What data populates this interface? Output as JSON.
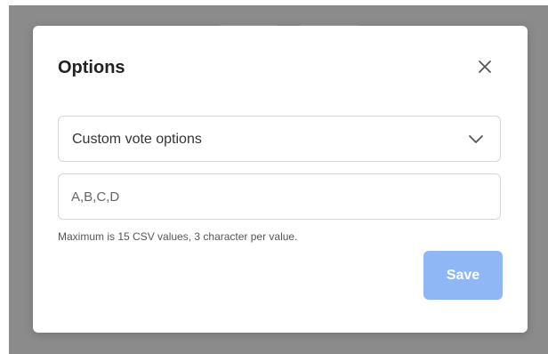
{
  "dialog": {
    "title": "Options",
    "close_icon": "close-icon",
    "select": {
      "selected_value": "Custom vote options",
      "chevron_icon": "chevron-down-icon"
    },
    "csv_input": {
      "value": "A,B,C,D",
      "placeholder": ""
    },
    "hint": "Maximum is 15 CSV values, 3 character per value.",
    "save_label": "Save"
  },
  "colors": {
    "backdrop": "#8b8b8b",
    "save_button": "#8fb7f5",
    "title_text": "#222222"
  }
}
